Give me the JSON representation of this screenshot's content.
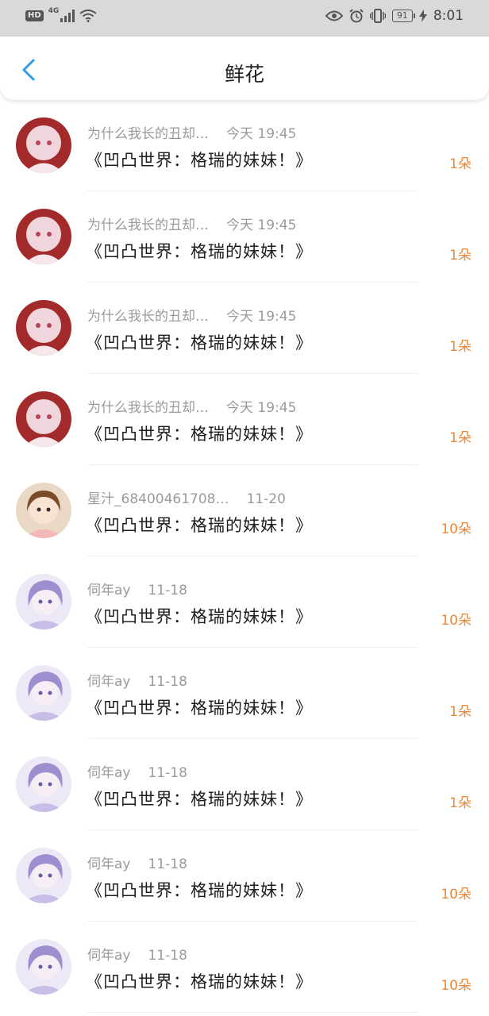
{
  "status_bar": {
    "hd": "HD",
    "network": "4G",
    "battery": "91",
    "time": "8:01"
  },
  "header": {
    "title": "鲜花"
  },
  "items": [
    {
      "user": "为什么我长的丑却…",
      "time": "今天 19:45",
      "book": "《凹凸世界：格瑞的妹妹！》",
      "count": "1朵",
      "avatar": "red"
    },
    {
      "user": "为什么我长的丑却…",
      "time": "今天 19:45",
      "book": "《凹凸世界：格瑞的妹妹！》",
      "count": "1朵",
      "avatar": "red"
    },
    {
      "user": "为什么我长的丑却…",
      "time": "今天 19:45",
      "book": "《凹凸世界：格瑞的妹妹！》",
      "count": "1朵",
      "avatar": "red"
    },
    {
      "user": "为什么我长的丑却…",
      "time": "今天 19:45",
      "book": "《凹凸世界：格瑞的妹妹！》",
      "count": "1朵",
      "avatar": "red"
    },
    {
      "user": "星汁_68400461708…",
      "time": "11-20",
      "book": "《凹凸世界：格瑞的妹妹！》",
      "count": "10朵",
      "avatar": "brown"
    },
    {
      "user": "伺年ay",
      "time": "11-18",
      "book": "《凹凸世界：格瑞的妹妹！》",
      "count": "10朵",
      "avatar": "purple"
    },
    {
      "user": "伺年ay",
      "time": "11-18",
      "book": "《凹凸世界：格瑞的妹妹！》",
      "count": "1朵",
      "avatar": "purple"
    },
    {
      "user": "伺年ay",
      "time": "11-18",
      "book": "《凹凸世界：格瑞的妹妹！》",
      "count": "1朵",
      "avatar": "purple"
    },
    {
      "user": "伺年ay",
      "time": "11-18",
      "book": "《凹凸世界：格瑞的妹妹！》",
      "count": "10朵",
      "avatar": "purple"
    },
    {
      "user": "伺年ay",
      "time": "11-18",
      "book": "《凹凸世界：格瑞的妹妹！》",
      "count": "10朵",
      "avatar": "purple"
    }
  ],
  "colors": {
    "accent": "#2f9ae8",
    "count": "#e7883a"
  }
}
